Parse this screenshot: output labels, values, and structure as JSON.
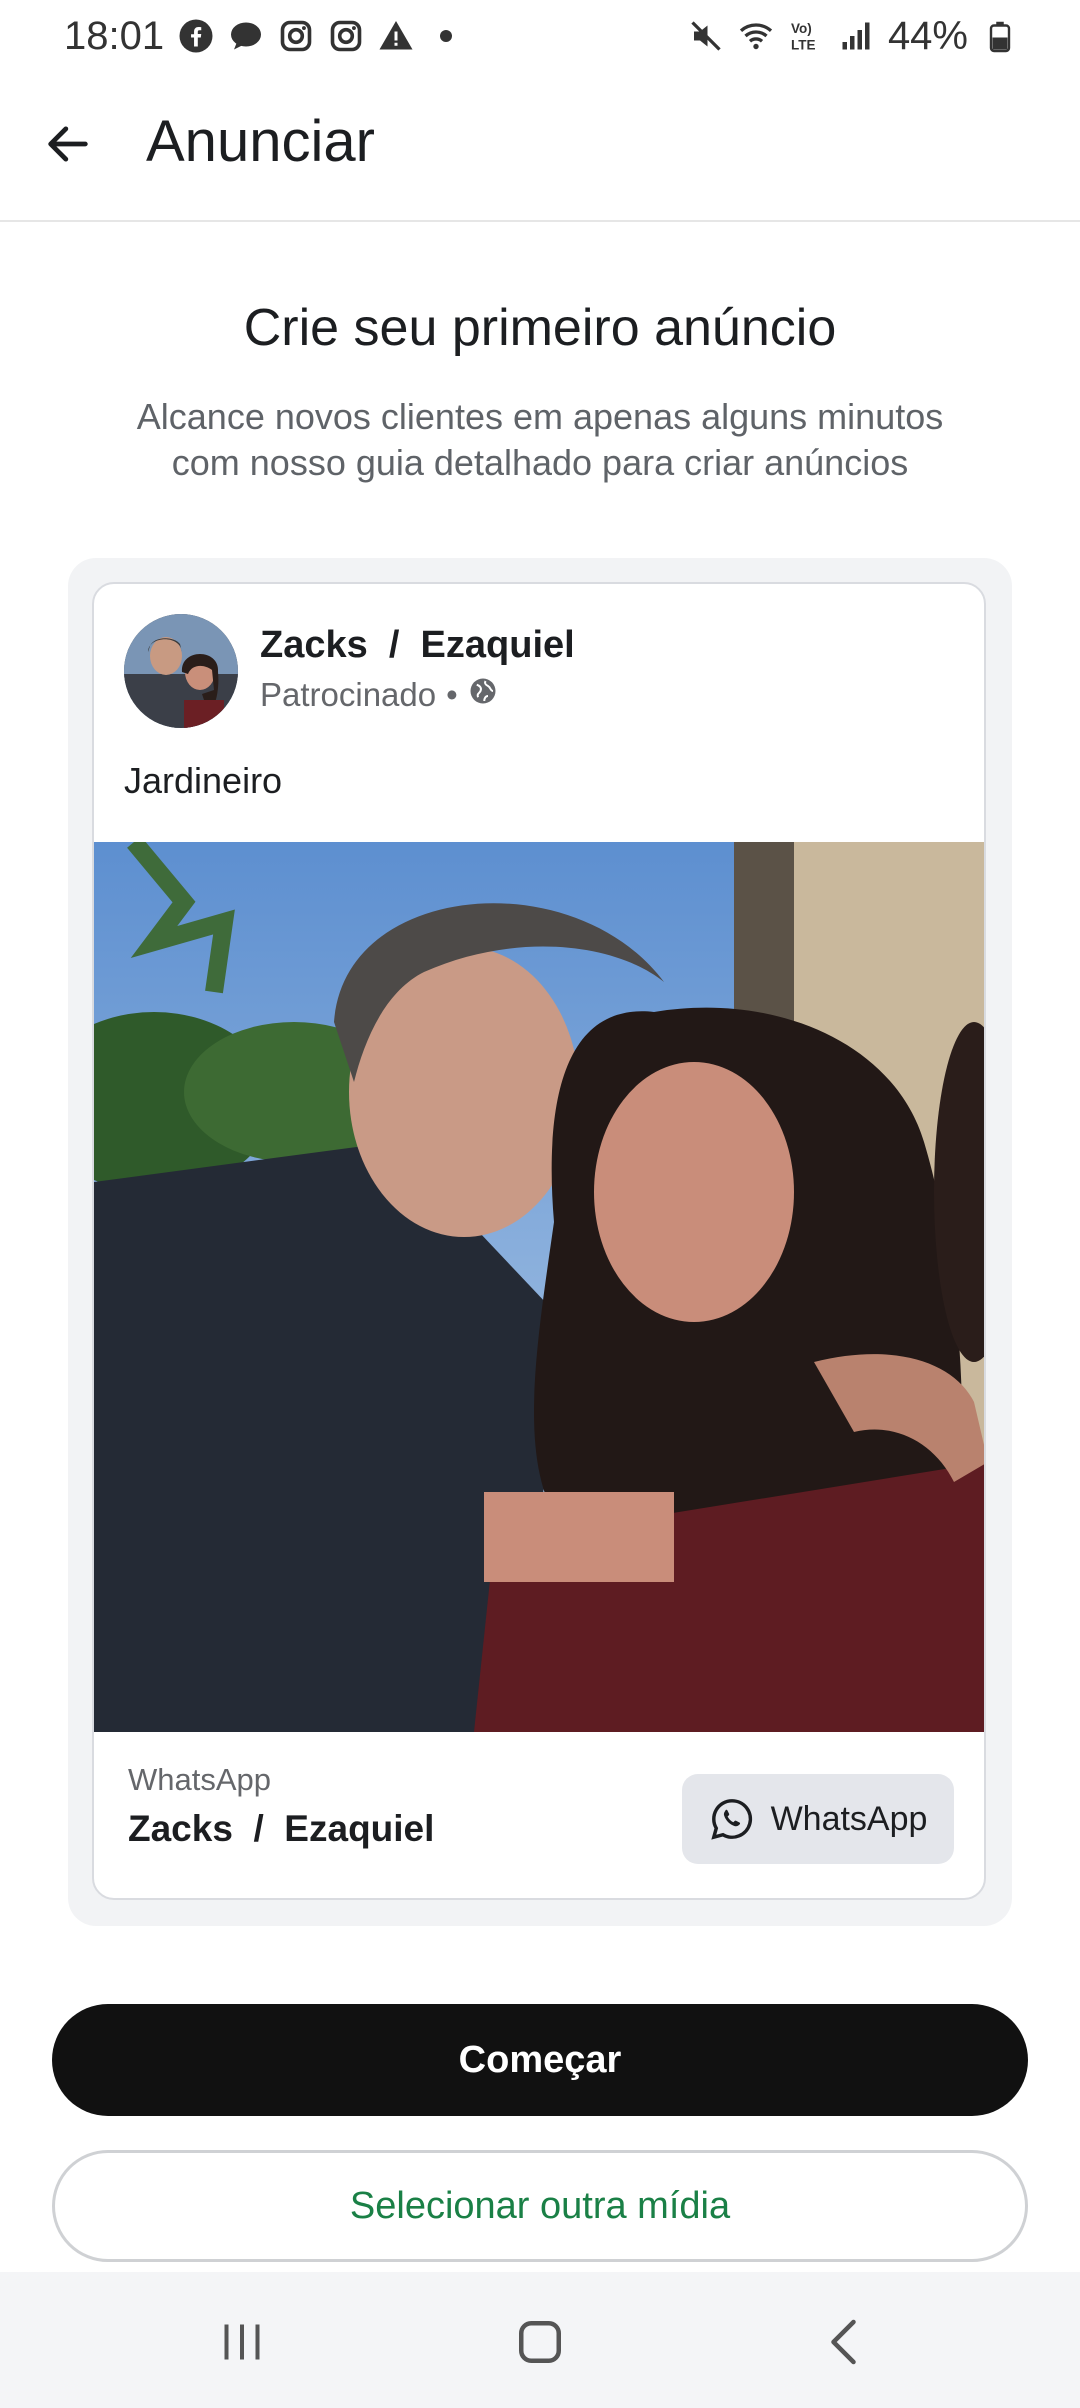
{
  "status_bar": {
    "time": "18:01",
    "icons_left": [
      "facebook-icon",
      "chat-bubble-icon",
      "instagram-icon",
      "instagram-icon",
      "warning-icon",
      "dot-icon"
    ],
    "icons_right": [
      "mute-icon",
      "wifi-icon",
      "volte-icon",
      "signal-icon",
      "battery-icon"
    ],
    "battery": "44%"
  },
  "header": {
    "title": "Anunciar"
  },
  "hero": {
    "title": "Crie seu primeiro anúncio",
    "subtitle_line1": "Alcance novos clientes em apenas alguns minutos",
    "subtitle_line2": "com nosso guia detalhado para criar anúncios"
  },
  "ad_preview": {
    "page_name": "Zacks  /  Ezaquiel",
    "sponsored": "Patrocinado",
    "separator": "•",
    "primary_text": "Jardineiro",
    "cta_source": "WhatsApp",
    "cta_name": "Zacks  /  Ezaquiel",
    "cta_button": "WhatsApp"
  },
  "actions": {
    "primary": "Começar",
    "secondary": "Selecionar outra mídia"
  },
  "colors": {
    "primary_button": "#111111",
    "secondary_text": "#1a8046",
    "card_border": "#d9dbe0"
  }
}
